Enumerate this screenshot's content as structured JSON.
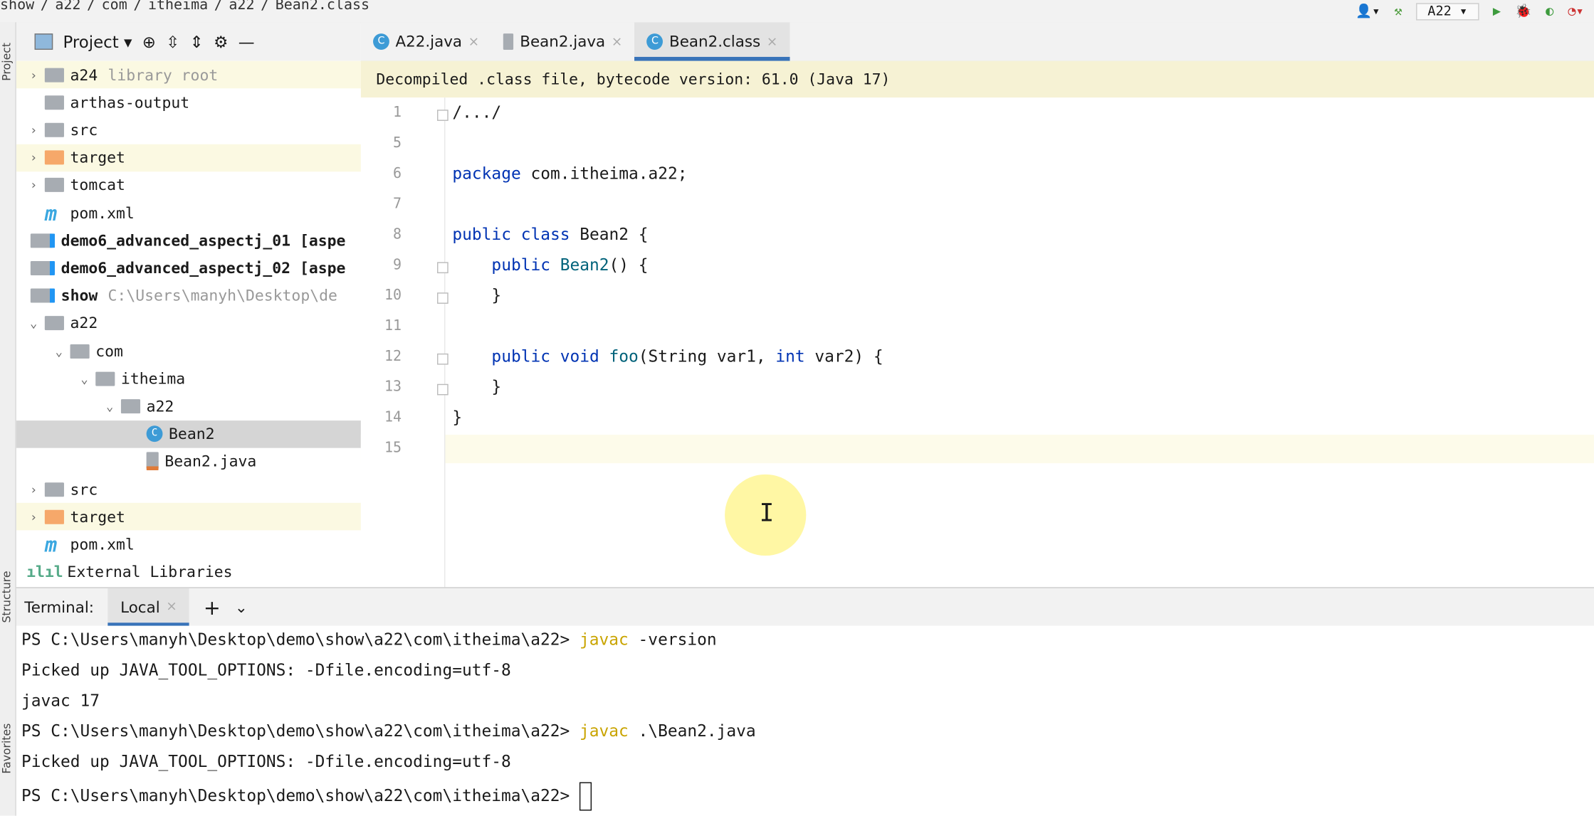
{
  "breadcrumb": [
    "show",
    "a22",
    "com",
    "itheima",
    "a22",
    "Bean2.class"
  ],
  "toolbar": {
    "run_config": "A22"
  },
  "side_labels": {
    "project": "Project",
    "structure": "Structure",
    "favorites": "Favorites"
  },
  "project_panel": {
    "title": "Project",
    "tree": [
      {
        "label": "a24",
        "hint": "library root",
        "depth": 0,
        "chev": "right",
        "icon": "folder",
        "hl": true
      },
      {
        "label": "arthas-output",
        "depth": 0,
        "chev": "",
        "icon": "folder"
      },
      {
        "label": "src",
        "depth": 0,
        "chev": "right",
        "icon": "folder"
      },
      {
        "label": "target",
        "depth": 0,
        "chev": "right",
        "icon": "folder-orange",
        "hl": true
      },
      {
        "label": "tomcat",
        "depth": 0,
        "chev": "right",
        "icon": "folder"
      },
      {
        "label": "pom.xml",
        "depth": 0,
        "chev": "",
        "icon": "maven"
      },
      {
        "label": "demo6_advanced_aspectj_01 [aspe",
        "depth": -1,
        "chev": "",
        "icon": "module",
        "bold": true
      },
      {
        "label": "demo6_advanced_aspectj_02 [aspe",
        "depth": -1,
        "chev": "",
        "icon": "module",
        "bold": true
      },
      {
        "label": "show",
        "hint": "C:\\Users\\manyh\\Desktop\\de",
        "depth": -1,
        "chev": "",
        "icon": "module",
        "bold": true
      },
      {
        "label": "a22",
        "depth": 0,
        "chev": "down",
        "icon": "folder"
      },
      {
        "label": "com",
        "depth": 1,
        "chev": "down",
        "icon": "folder"
      },
      {
        "label": "itheima",
        "depth": 2,
        "chev": "down",
        "icon": "folder"
      },
      {
        "label": "a22",
        "depth": 3,
        "chev": "down",
        "icon": "folder"
      },
      {
        "label": "Bean2",
        "depth": 4,
        "chev": "",
        "icon": "class",
        "sel": true
      },
      {
        "label": "Bean2.java",
        "depth": 4,
        "chev": "",
        "icon": "java"
      },
      {
        "label": "src",
        "depth": 0,
        "chev": "right",
        "icon": "folder"
      },
      {
        "label": "target",
        "depth": 0,
        "chev": "right",
        "icon": "folder-orange",
        "hl": true
      },
      {
        "label": "pom.xml",
        "depth": 0,
        "chev": "",
        "icon": "maven"
      },
      {
        "label": "External Libraries",
        "depth": -1,
        "chev": "",
        "icon": "libraries"
      }
    ]
  },
  "tabs": [
    {
      "label": "A22.java",
      "active": false
    },
    {
      "label": "Bean2.java",
      "active": false
    },
    {
      "label": "Bean2.class",
      "active": true
    }
  ],
  "editor": {
    "banner": "Decompiled .class file, bytecode version: 61.0 (Java 17)",
    "lines": [
      {
        "n": "1",
        "html": "/.../"
      },
      {
        "n": "5",
        "html": ""
      },
      {
        "n": "6",
        "html": "<span class='kw'>package</span> com.itheima.a22;"
      },
      {
        "n": "7",
        "html": ""
      },
      {
        "n": "8",
        "html": "<span class='kw'>public class</span> Bean2 {"
      },
      {
        "n": "9",
        "html": "    <span class='kw'>public</span> <span class='fn'>Bean2</span>() {"
      },
      {
        "n": "10",
        "html": "    }"
      },
      {
        "n": "11",
        "html": ""
      },
      {
        "n": "12",
        "html": "    <span class='kw'>public void</span> <span class='fn'>foo</span>(String var1, <span class='kw'>int</span> var2) {"
      },
      {
        "n": "13",
        "html": "    }"
      },
      {
        "n": "14",
        "html": "}"
      },
      {
        "n": "15",
        "html": ""
      }
    ]
  },
  "terminal": {
    "label": "Terminal:",
    "tab": "Local",
    "lines": [
      {
        "prompt": "PS C:\\Users\\manyh\\Desktop\\demo\\show\\a22\\com\\itheima\\a22> ",
        "cmd": "javac",
        "args": " -version"
      },
      {
        "text": "Picked up JAVA_TOOL_OPTIONS: -Dfile.encoding=utf-8"
      },
      {
        "text": "javac 17"
      },
      {
        "prompt": "PS C:\\Users\\manyh\\Desktop\\demo\\show\\a22\\com\\itheima\\a22> ",
        "cmd": "javac",
        "args": " .\\Bean2.java"
      },
      {
        "text": "Picked up JAVA_TOOL_OPTIONS: -Dfile.encoding=utf-8"
      },
      {
        "prompt": "PS C:\\Users\\manyh\\Desktop\\demo\\show\\a22\\com\\itheima\\a22> ",
        "cursor": true
      }
    ]
  }
}
